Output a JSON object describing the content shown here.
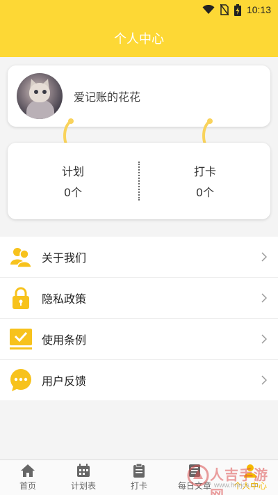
{
  "status_bar": {
    "time": "10:13"
  },
  "header": {
    "title": "个人中心"
  },
  "profile": {
    "nickname": "爱记账的花花"
  },
  "stats": [
    {
      "label": "计划",
      "value": "0个"
    },
    {
      "label": "打卡",
      "value": "0个"
    }
  ],
  "menu": [
    {
      "label": "关于我们",
      "icon": "users-icon"
    },
    {
      "label": "隐私政策",
      "icon": "lock-icon"
    },
    {
      "label": "使用条例",
      "icon": "checkbox-icon"
    },
    {
      "label": "用户反馈",
      "icon": "chat-bubble-icon"
    }
  ],
  "tabs": [
    {
      "label": "首页",
      "icon": "home-icon"
    },
    {
      "label": "计划表",
      "icon": "calendar-icon"
    },
    {
      "label": "打卡",
      "icon": "clipboard-icon"
    },
    {
      "label": "每日文章",
      "icon": "article-icon"
    },
    {
      "label": "个人中心",
      "icon": "person-icon",
      "active": true
    }
  ],
  "watermark": {
    "text": "人吉手游网",
    "url": "www.hnrjcs.cn"
  },
  "colors": {
    "accent": "#fdd835",
    "icon_yellow": "#f7c21c",
    "active_tab": "#f5b800"
  }
}
